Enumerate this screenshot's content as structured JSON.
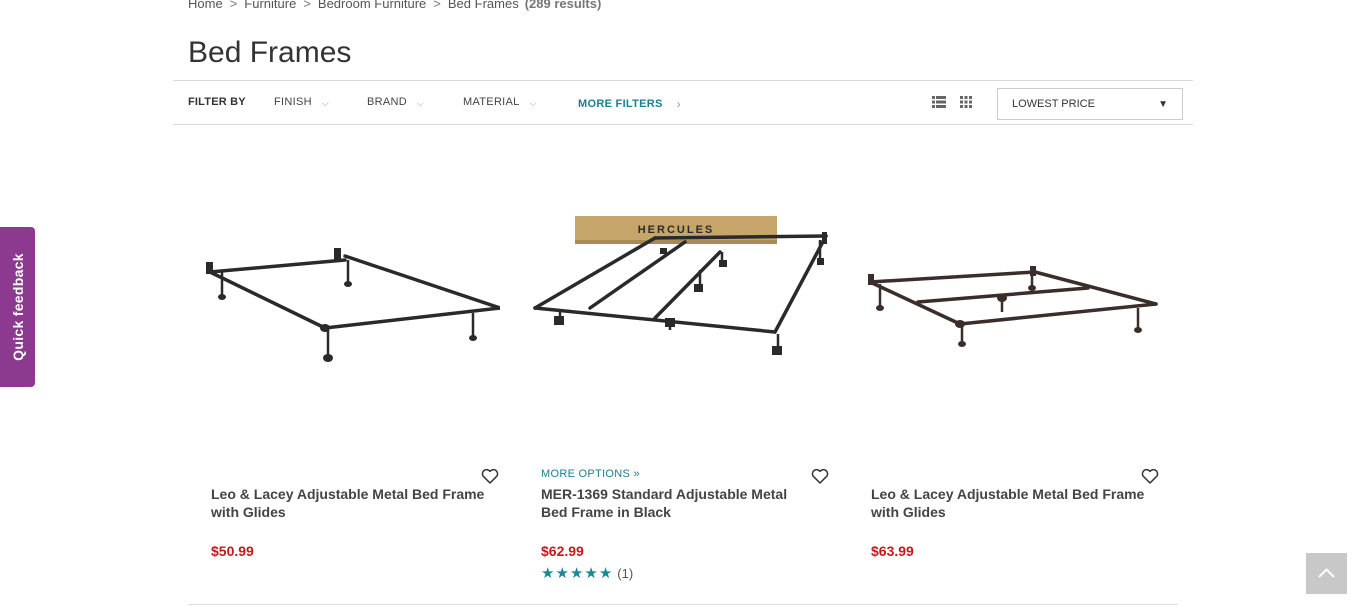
{
  "breadcrumb": {
    "items": [
      "Home",
      "Furniture",
      "Bedroom Furniture",
      "Bed Frames"
    ],
    "separator": ">",
    "results": "(289 results)"
  },
  "page_title": "Bed Frames",
  "filters": {
    "label": "FILTER BY",
    "items": [
      "FINISH",
      "BRAND",
      "MATERIAL"
    ],
    "more": "MORE FILTERS"
  },
  "sort": {
    "selected": "LOWEST PRICE"
  },
  "view_icons": [
    "list-view-icon",
    "grid-view-icon"
  ],
  "products": [
    {
      "name_line1": "Leo & Lacey Adjustable Metal Bed Frame",
      "name_line2": "with Glides",
      "price": "$50.99",
      "more_options": null,
      "rating": null
    },
    {
      "name_line1": "MER-1369 Standard Adjustable Metal",
      "name_line2": "Bed Frame in Black",
      "price": "$62.99",
      "more_options": "MORE OPTIONS »",
      "box_brand": "HERCULES",
      "rating": {
        "stars": 5,
        "count": "(1)"
      }
    },
    {
      "name_line1": "Leo & Lacey Adjustable Metal Bed Frame",
      "name_line2": "with Glides",
      "price": "$63.99",
      "more_options": null,
      "rating": null
    }
  ],
  "feedback_tab": {
    "label": "Quick feedback"
  },
  "colors": {
    "accent": "#1a7f8e",
    "price": "#c41a1a",
    "feedback": "#8b3a8f",
    "star": "#1a8a96"
  }
}
